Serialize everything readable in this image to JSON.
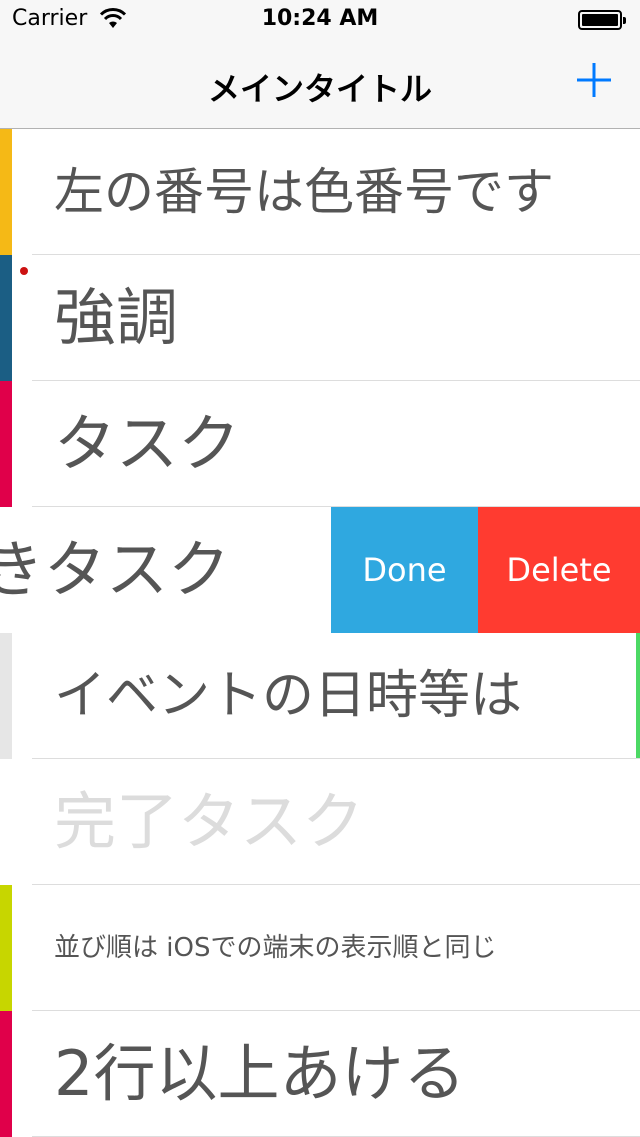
{
  "status_bar": {
    "carrier": "Carrier",
    "time": "10:24 AM"
  },
  "nav_bar": {
    "title": "メインタイトル",
    "add_icon": "plus-icon",
    "tint": "#007aff"
  },
  "rows": [
    {
      "label": "左の番号は色番号です",
      "color": "#f5b916"
    },
    {
      "label": "強調",
      "color": "#1b5e84"
    },
    {
      "label": "タスク",
      "color": "#e0004a"
    },
    {
      "label": "きタスク",
      "color": "#ffffff"
    },
    {
      "label": "イベントの日時等は",
      "color": "#e6e6e6"
    },
    {
      "label": "完了タスク",
      "color": "#ffffff"
    },
    {
      "label": "並び順は iOSでの端末の表示順と同じ",
      "color": "#c7d600"
    },
    {
      "label": "2行以上あける",
      "color": "#e0004a"
    }
  ],
  "swipe_actions": {
    "done_label": "Done",
    "delete_label": "Delete",
    "done_color": "#2fa8e0",
    "delete_color": "#ff3b30"
  }
}
